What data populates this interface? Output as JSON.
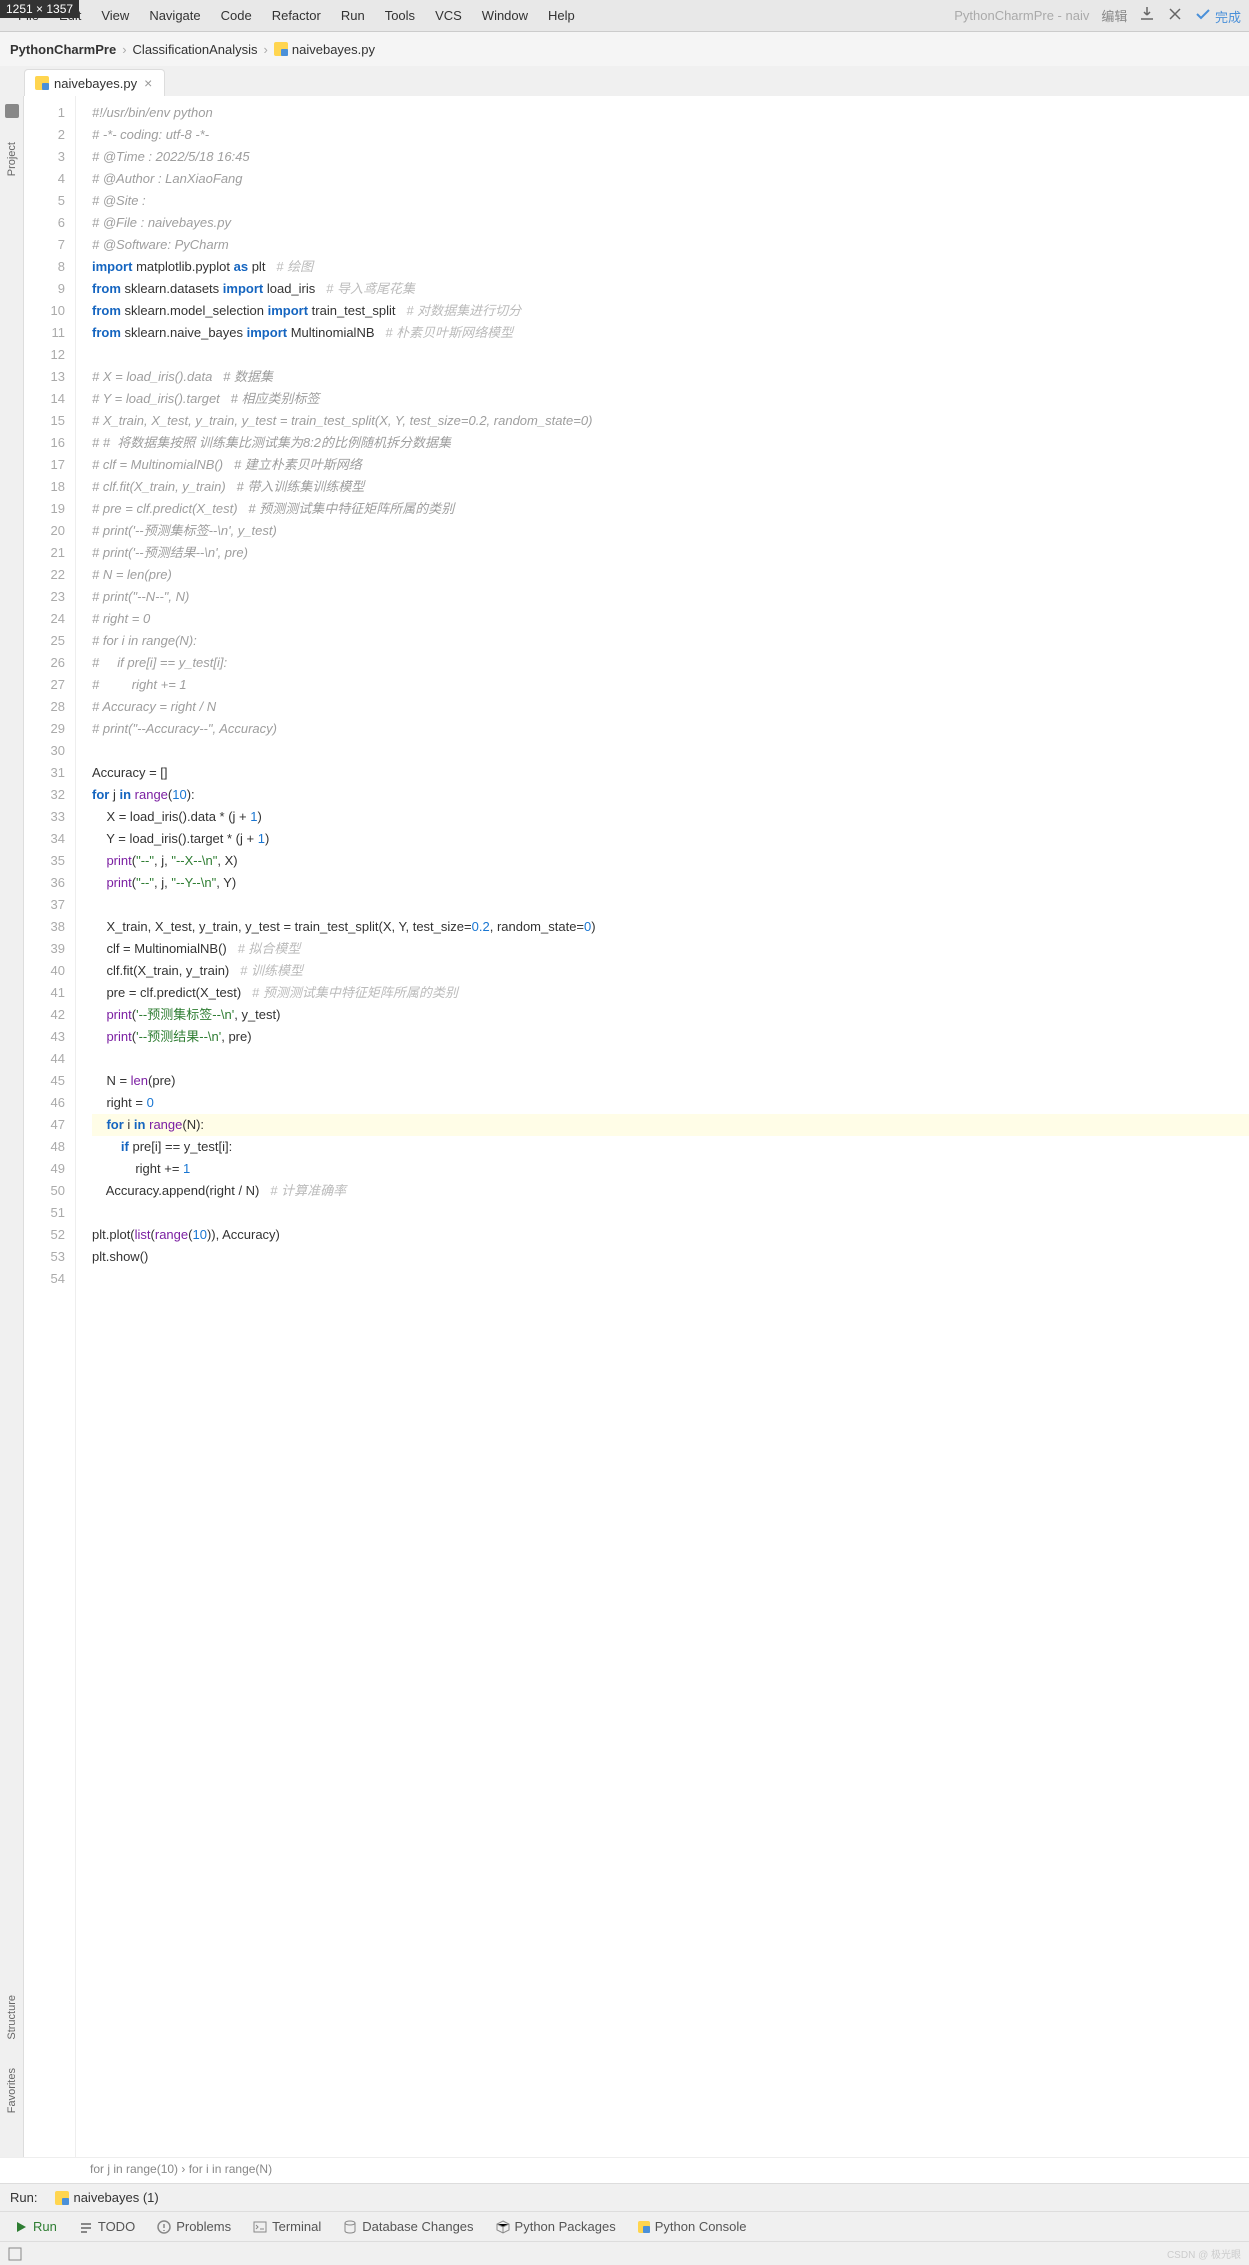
{
  "dim_badge": "1251 × 1357",
  "menubar": {
    "items": [
      "File",
      "Edit",
      "View",
      "Navigate",
      "Code",
      "Refactor",
      "Run",
      "Tools",
      "VCS",
      "Window",
      "Help"
    ],
    "title_faded": "PythonCharmPre - naiv",
    "edit_cn": "编辑",
    "done": "完成"
  },
  "breadcrumb": {
    "project": "PythonCharmPre",
    "folder": "ClassificationAnalysis",
    "file": "naivebayes.py"
  },
  "tab": {
    "name": "naivebayes.py"
  },
  "rails": {
    "project": "Project",
    "structure": "Structure",
    "favorites": "Favorites"
  },
  "code_lines": [
    [
      [
        "c",
        "#!/usr/bin/env python"
      ]
    ],
    [
      [
        "c",
        "# -*- coding: utf-8 -*-"
      ]
    ],
    [
      [
        "c",
        "# @Time : 2022/5/18 16:45"
      ]
    ],
    [
      [
        "c",
        "# @Author : LanXiaoFang"
      ]
    ],
    [
      [
        "c",
        "# @Site : "
      ]
    ],
    [
      [
        "c",
        "# @File : "
      ],
      [
        "c",
        "naivebayes"
      ],
      [
        "c",
        ".py"
      ]
    ],
    [
      [
        "c",
        "# @Software: PyCharm"
      ]
    ],
    [
      [
        "k",
        "import"
      ],
      [
        "",
        " matplotlib.pyplot "
      ],
      [
        "k",
        "as"
      ],
      [
        "",
        " plt   "
      ],
      [
        "cc",
        "# 绘图"
      ]
    ],
    [
      [
        "k",
        "from"
      ],
      [
        "",
        " sklearn.datasets "
      ],
      [
        "k",
        "import"
      ],
      [
        "",
        " load_iris   "
      ],
      [
        "cc",
        "# 导入鸢尾花集"
      ]
    ],
    [
      [
        "k",
        "from"
      ],
      [
        "",
        " sklearn.model_selection "
      ],
      [
        "k",
        "import"
      ],
      [
        "",
        " train_test_split   "
      ],
      [
        "cc",
        "# 对数据集进行切分"
      ]
    ],
    [
      [
        "k",
        "from"
      ],
      [
        "",
        " sklearn.naive_bayes "
      ],
      [
        "k",
        "import"
      ],
      [
        "",
        " MultinomialNB   "
      ],
      [
        "cc",
        "# 朴素贝叶斯网络模型"
      ]
    ],
    [],
    [
      [
        "c",
        "# X = load_iris().data   # 数据集"
      ]
    ],
    [
      [
        "c",
        "# Y = load_iris().target   # 相应类别标签"
      ]
    ],
    [
      [
        "c",
        "# X_train, X_test, y_train, y_test = train_test_split(X, Y, test_size=0.2, random_state=0)"
      ]
    ],
    [
      [
        "c",
        "# #  将数据集按照 训练集比测试集为8:2的比例随机拆分数据集"
      ]
    ],
    [
      [
        "c",
        "# clf = MultinomialNB()   # 建立朴素贝叶斯网络"
      ]
    ],
    [
      [
        "c",
        "# clf.fit(X_train, y_train)   # 带入训练集训练模型"
      ]
    ],
    [
      [
        "c",
        "# pre = clf.predict(X_test)   # 预测测试集中特征矩阵所属的类别"
      ]
    ],
    [
      [
        "c",
        "# print('--预测集标签--\\n', y_test)"
      ]
    ],
    [
      [
        "c",
        "# print('--预测结果--\\n', pre)"
      ]
    ],
    [
      [
        "c",
        "# N = len(pre)"
      ]
    ],
    [
      [
        "c",
        "# print(\"--N--\", N)"
      ]
    ],
    [
      [
        "c",
        "# right = 0"
      ]
    ],
    [
      [
        "c",
        "# for i in range(N):"
      ]
    ],
    [
      [
        "c",
        "#     if pre[i] == y_test[i]:"
      ]
    ],
    [
      [
        "c",
        "#         right += 1"
      ]
    ],
    [
      [
        "c",
        "# Accuracy = right / N"
      ]
    ],
    [
      [
        "c",
        "# print(\"--Accuracy--\", Accuracy)"
      ]
    ],
    [],
    [
      [
        "",
        "Accuracy = []"
      ]
    ],
    [
      [
        "k",
        "for"
      ],
      [
        "",
        " j "
      ],
      [
        "k",
        "in"
      ],
      [
        "",
        " "
      ],
      [
        "fn",
        "range"
      ],
      [
        "",
        "("
      ],
      [
        "n",
        "10"
      ],
      [
        "",
        "):"
      ]
    ],
    [
      [
        "",
        "    X = load_iris().data * (j + "
      ],
      [
        "n",
        "1"
      ],
      [
        "",
        ")"
      ]
    ],
    [
      [
        "",
        "    Y = load_iris().target * (j + "
      ],
      [
        "n",
        "1"
      ],
      [
        "",
        ")"
      ]
    ],
    [
      [
        "",
        "    "
      ],
      [
        "fn",
        "print"
      ],
      [
        "",
        "("
      ],
      [
        "s",
        "\"--\""
      ],
      [
        "",
        ", j, "
      ],
      [
        "s",
        "\"--X--\\n\""
      ],
      [
        "",
        ", X)"
      ]
    ],
    [
      [
        "",
        "    "
      ],
      [
        "fn",
        "print"
      ],
      [
        "",
        "("
      ],
      [
        "s",
        "\"--\""
      ],
      [
        "",
        ", j, "
      ],
      [
        "s",
        "\"--Y--\\n\""
      ],
      [
        "",
        ", Y)"
      ]
    ],
    [],
    [
      [
        "",
        "    X_train, X_test, y_train, y_test = train_test_split(X, Y, "
      ],
      [
        "",
        "test_size="
      ],
      [
        "n",
        "0.2"
      ],
      [
        "",
        ", "
      ],
      [
        "",
        "random_state="
      ],
      [
        "n",
        "0"
      ],
      [
        "",
        ")"
      ]
    ],
    [
      [
        "",
        "    clf = MultinomialNB()   "
      ],
      [
        "cc",
        "# 拟合模型"
      ]
    ],
    [
      [
        "",
        "    clf.fit(X_train, y_train)   "
      ],
      [
        "cc",
        "# 训练模型"
      ]
    ],
    [
      [
        "",
        "    pre = clf.predict(X_test)   "
      ],
      [
        "cc",
        "# 预测测试集中特征矩阵所属的类别"
      ]
    ],
    [
      [
        "",
        "    "
      ],
      [
        "fn",
        "print"
      ],
      [
        "",
        "("
      ],
      [
        "s",
        "'--预测集标签--\\n'"
      ],
      [
        "",
        ", y_test)"
      ]
    ],
    [
      [
        "",
        "    "
      ],
      [
        "fn",
        "print"
      ],
      [
        "",
        "("
      ],
      [
        "s",
        "'--预测结果--\\n'"
      ],
      [
        "",
        ", pre)"
      ]
    ],
    [],
    [
      [
        "",
        "    N = "
      ],
      [
        "fn",
        "len"
      ],
      [
        "",
        "(pre)"
      ]
    ],
    [
      [
        "",
        "    right = "
      ],
      [
        "n",
        "0"
      ]
    ],
    [
      [
        "",
        "    "
      ],
      [
        "k",
        "for"
      ],
      [
        "",
        " i "
      ],
      [
        "k",
        "in"
      ],
      [
        "",
        " "
      ],
      [
        "fn",
        "range"
      ],
      [
        "",
        "(N):"
      ]
    ],
    [
      [
        "",
        "        "
      ],
      [
        "k",
        "if"
      ],
      [
        "",
        " pre[i] == y_test[i]:"
      ]
    ],
    [
      [
        "",
        "            right += "
      ],
      [
        "n",
        "1"
      ]
    ],
    [
      [
        "",
        "    Accuracy.append(right / N)   "
      ],
      [
        "cc",
        "# 计算准确率"
      ]
    ],
    [],
    [
      [
        "",
        "plt.plot("
      ],
      [
        "fn",
        "list"
      ],
      [
        "",
        "("
      ],
      [
        "fn",
        "range"
      ],
      [
        "",
        "("
      ],
      [
        "n",
        "10"
      ],
      [
        "",
        ")), Accuracy)"
      ]
    ],
    [
      [
        "",
        "plt.show()"
      ]
    ],
    []
  ],
  "highlight_line": 47,
  "crumb_trail": "for j in range(10)  ›  for i in range(N)",
  "run_panel": {
    "label": "Run:",
    "tab": "naivebayes (1)"
  },
  "bottom_tabs": {
    "run": "Run",
    "todo": "TODO",
    "problems": "Problems",
    "terminal": "Terminal",
    "db": "Database Changes",
    "pkg": "Python Packages",
    "console": "Python Console"
  },
  "watermark": "CSDN @ 极光眼"
}
